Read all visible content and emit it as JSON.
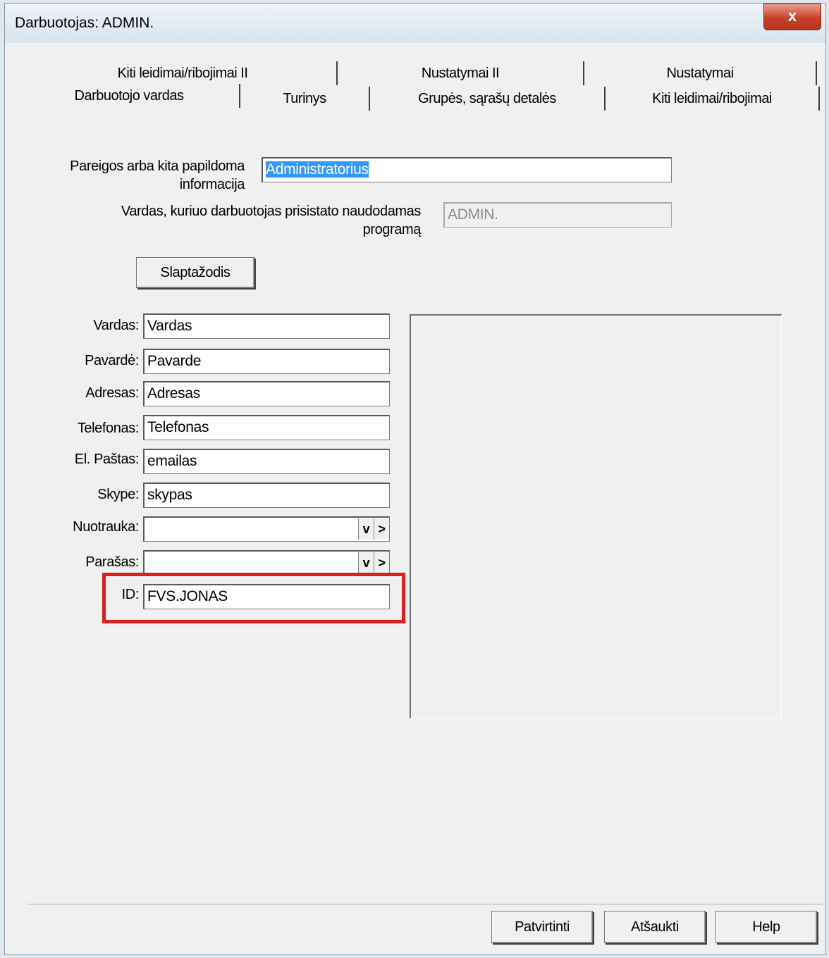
{
  "window": {
    "title": "Darbuotojas: ADMIN.",
    "close_label": "x"
  },
  "tabs": {
    "row1": [
      "Kiti leidimai/ribojimai II",
      "Nustatymai II",
      "Nustatymai"
    ],
    "row2": [
      "Darbuotojo vardas",
      "Turinys",
      "Grupės, sąrašų detalės",
      "Kiti leidimai/ribojimai"
    ],
    "active": "Darbuotojo vardas"
  },
  "form": {
    "position_label": "Pareigos arba kita papildoma informacija",
    "position_label_line1": "Pareigos arba kita papildoma",
    "position_label_line2": "informacija",
    "position_value": "Administratorius",
    "login_label_line1": "Vardas, kuriuo darbuotojas prisistato naudodamas",
    "login_label_line2": "programą",
    "login_value": "ADMIN.",
    "password_button": "Slaptažodis",
    "fields": [
      {
        "label": "Vardas:",
        "value": "Vardas"
      },
      {
        "label": "Pavardė:",
        "value": "Pavarde"
      },
      {
        "label": "Adresas:",
        "value": "Adresas"
      },
      {
        "label": "Telefonas:",
        "value": "Telefonas"
      },
      {
        "label": "El. Paštas:",
        "value": "emailas"
      },
      {
        "label": "Skype:",
        "value": "skypas"
      }
    ],
    "photo_label": "Nuotrauka:",
    "photo_value": "",
    "signature_label": "Parašas:",
    "signature_value": "",
    "combo_dropdown_glyph": "v",
    "combo_next_glyph": ">",
    "id_label": "ID:",
    "id_value": "FVS.JONAS"
  },
  "footer": {
    "confirm": "Patvirtinti",
    "cancel": "Atšaukti",
    "help": "Help"
  },
  "colors": {
    "highlight_border": "#d9201e",
    "selection": "#3399ff"
  }
}
